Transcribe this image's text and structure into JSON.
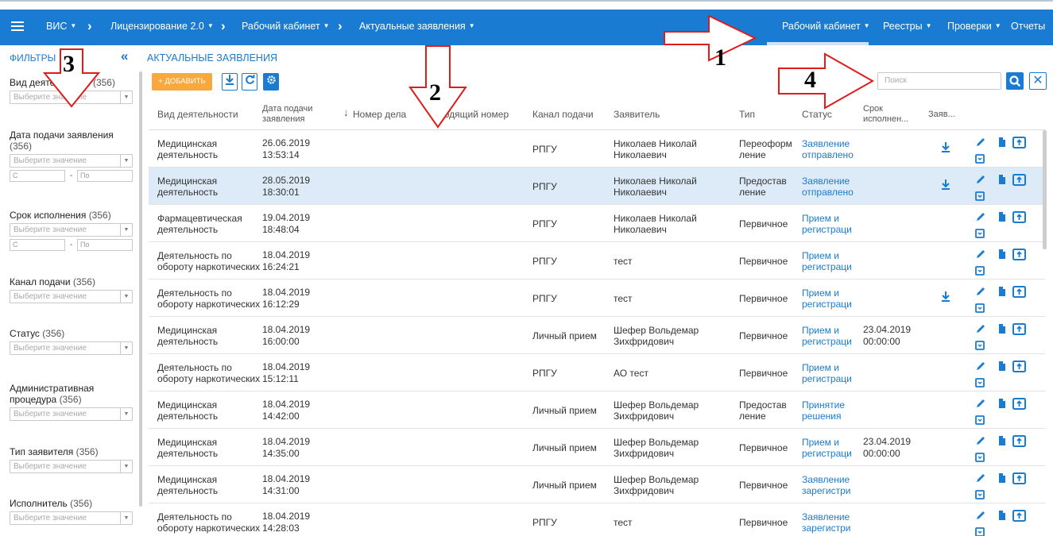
{
  "topbar": {
    "app": "ВИС",
    "breadcrumbs": [
      "Лицензирование 2.0",
      "Рабочий кабинет",
      "Актуальные заявления"
    ],
    "nav": [
      "Рабочий кабинет",
      "Реестры",
      "Проверки",
      "Отчеты"
    ]
  },
  "sidebar": {
    "title": "ФИЛЬТРЫ",
    "select_placeholder": "Выберите значение",
    "range_from": "С",
    "range_to": "По",
    "filters": [
      {
        "label": "Вид деятельности",
        "count": "(356)"
      },
      {
        "label": "Дата подачи заявления",
        "count": "(356)"
      },
      {
        "label": "Срок исполнения",
        "count": "(356)"
      },
      {
        "label": "Канал подачи",
        "count": "(356)"
      },
      {
        "label": "Статус",
        "count": "(356)"
      },
      {
        "label": "Административная процедура",
        "count": "(356)"
      },
      {
        "label": "Тип заявителя",
        "count": "(356)"
      },
      {
        "label": "Исполнитель",
        "count": "(356)"
      }
    ]
  },
  "main": {
    "title": "АКТУАЛЬНЫЕ ЗАЯВЛЕНИЯ",
    "add_label": "+ ДОБАВИТЬ",
    "search_placeholder": "Поиск",
    "columns": [
      "Вид деятельности",
      "Дата подачи заявления",
      "Номер дела",
      "Входящий номер",
      "Канал подачи",
      "Заявитель",
      "Тип",
      "Статус",
      "Срок исполнен...",
      "Заяв..."
    ],
    "rows": [
      {
        "activity": "Медицинская деятельность",
        "date": "26.06.2019",
        "time": "13:53:14",
        "channel": "РПГУ",
        "applicant": "Николаев Николай Николаевич",
        "type": "Переоформ ление",
        "status": "Заявление отправлено",
        "due": "",
        "due_time": "",
        "download": true
      },
      {
        "activity": "Медицинская деятельность",
        "date": "28.05.2019",
        "time": "18:30:01",
        "channel": "РПГУ",
        "applicant": "Николаев Николай Николаевич",
        "type": "Предостав ление",
        "status": "Заявление отправлено",
        "due": "",
        "due_time": "",
        "download": true
      },
      {
        "activity": "Фармацевтическая деятельность",
        "date": "19.04.2019",
        "time": "18:48:04",
        "channel": "РПГУ",
        "applicant": "Николаев Николай Николаевич",
        "type": "Первичное",
        "status": "Прием и регистраци",
        "due": "",
        "due_time": "",
        "download": false
      },
      {
        "activity": "Деятельность по обороту наркотических",
        "date": "18.04.2019",
        "time": "16:24:21",
        "channel": "РПГУ",
        "applicant": "тест",
        "type": "Первичное",
        "status": "Прием и регистраци",
        "due": "",
        "due_time": "",
        "download": false
      },
      {
        "activity": "Деятельность по обороту наркотических",
        "date": "18.04.2019",
        "time": "16:12:29",
        "channel": "РПГУ",
        "applicant": "тест",
        "type": "Первичное",
        "status": "Прием и регистраци",
        "due": "",
        "due_time": "",
        "download": true
      },
      {
        "activity": "Медицинская деятельность",
        "date": "18.04.2019",
        "time": "16:00:00",
        "channel": "Личный прием",
        "applicant": "Шефер Вольдемар Зихфридович",
        "type": "Первичное",
        "status": "Прием и регистраци",
        "due": "23.04.2019",
        "due_time": "00:00:00",
        "download": false
      },
      {
        "activity": "Деятельность по обороту наркотических",
        "date": "18.04.2019",
        "time": "15:12:11",
        "channel": "РПГУ",
        "applicant": "АО тест",
        "type": "Первичное",
        "status": "Прием и регистраци",
        "due": "",
        "due_time": "",
        "download": false
      },
      {
        "activity": "Медицинская деятельность",
        "date": "18.04.2019",
        "time": "14:42:00",
        "channel": "Личный прием",
        "applicant": "Шефер Вольдемар Зихфридович",
        "type": "Предостав ление",
        "status": "Принятие решения",
        "due": "",
        "due_time": "",
        "download": false
      },
      {
        "activity": "Медицинская деятельность",
        "date": "18.04.2019",
        "time": "14:35:00",
        "channel": "Личный прием",
        "applicant": "Шефер Вольдемар Зихфридович",
        "type": "Первичное",
        "status": "Прием и регистраци",
        "due": "23.04.2019",
        "due_time": "00:00:00",
        "download": false
      },
      {
        "activity": "Медицинская деятельность",
        "date": "18.04.2019",
        "time": "14:31:00",
        "channel": "Личный прием",
        "applicant": "Шефер Вольдемар Зихфридович",
        "type": "Первичное",
        "status": "Заявление зарегистри",
        "due": "",
        "due_time": "",
        "download": false
      },
      {
        "activity": "Деятельность по обороту наркотических",
        "date": "18.04.2019",
        "time": "14:28:03",
        "channel": "РПГУ",
        "applicant": "тест",
        "type": "Первичное",
        "status": "Заявление зарегистри",
        "due": "",
        "due_time": "",
        "download": false
      }
    ]
  },
  "annotations": [
    "1",
    "2",
    "3",
    "4"
  ],
  "colors": {
    "primary": "#1a7bd2",
    "accent": "#f9a83d",
    "selected_row": "#dcebf7",
    "arrow": "#e01c1c"
  }
}
